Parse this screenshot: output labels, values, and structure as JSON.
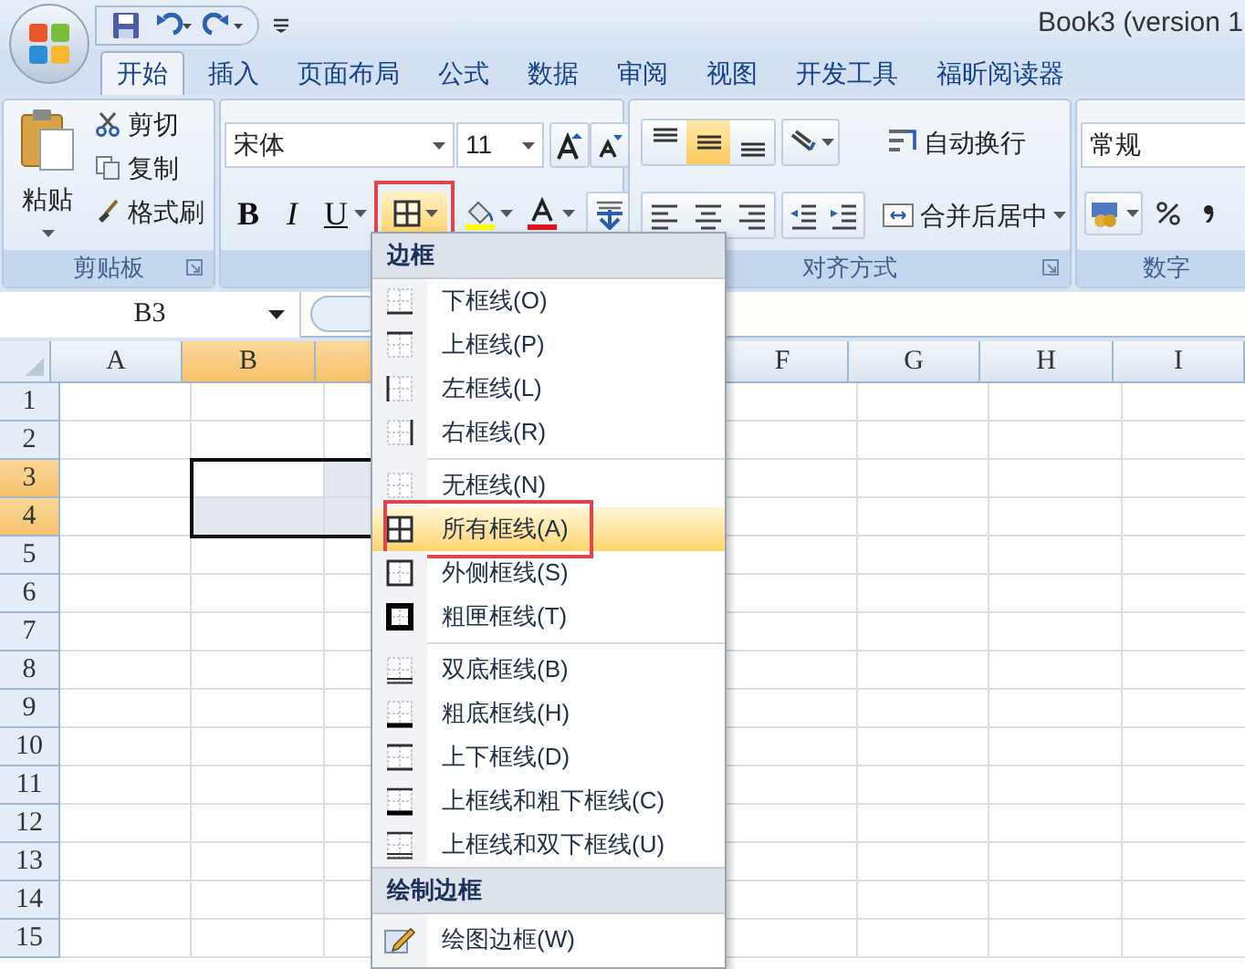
{
  "title_bar": {
    "title": "Book3 (version 1"
  },
  "tabs": [
    {
      "label": "开始",
      "selected": true
    },
    {
      "label": "插入",
      "selected": false
    },
    {
      "label": "页面布局",
      "selected": false
    },
    {
      "label": "公式",
      "selected": false
    },
    {
      "label": "数据",
      "selected": false
    },
    {
      "label": "审阅",
      "selected": false
    },
    {
      "label": "视图",
      "selected": false
    },
    {
      "label": "开发工具",
      "selected": false
    },
    {
      "label": "福昕阅读器",
      "selected": false
    }
  ],
  "ribbon": {
    "clipboard": {
      "paste": "粘贴",
      "commands": [
        {
          "kind": "cut",
          "label": "剪切"
        },
        {
          "kind": "copy",
          "label": "复制"
        },
        {
          "kind": "format_painter",
          "label": "格式刷"
        }
      ],
      "group_label": "剪贴板"
    },
    "font": {
      "font_name": "宋体",
      "font_size": "11",
      "bold": "B",
      "italic": "I",
      "underline": "U",
      "border_button": {
        "annotated": true
      }
    },
    "alignment": {
      "vertical_align": [
        {
          "kind": "top",
          "selected": false
        },
        {
          "kind": "middle",
          "selected": true
        },
        {
          "kind": "bottom",
          "selected": false
        }
      ],
      "wrap_text": "自动换行",
      "merge_center": "合并后居中",
      "group_label": "对齐方式"
    },
    "number": {
      "format": "常规",
      "group_label": "数字"
    }
  },
  "name_box": {
    "value": "B3"
  },
  "sheet": {
    "columns": [
      {
        "label": "A",
        "selected": false
      },
      {
        "label": "B",
        "selected": true
      },
      {
        "selected": true
      },
      {
        "label": "F",
        "selected": false
      },
      {
        "label": "G",
        "selected": false
      },
      {
        "label": "H",
        "selected": false
      },
      {
        "label": "I",
        "selected": false
      }
    ],
    "rows": [
      {
        "label": "1",
        "selected": false
      },
      {
        "label": "2",
        "selected": false
      },
      {
        "label": "3",
        "selected": true
      },
      {
        "label": "4",
        "selected": true
      },
      {
        "label": "5",
        "selected": false
      },
      {
        "label": "6",
        "selected": false
      },
      {
        "label": "7",
        "selected": false
      },
      {
        "label": "8",
        "selected": false
      },
      {
        "label": "9",
        "selected": false
      },
      {
        "label": "10",
        "selected": false
      },
      {
        "label": "11",
        "selected": false
      },
      {
        "label": "12",
        "selected": false
      },
      {
        "label": "13",
        "selected": false
      },
      {
        "label": "14",
        "selected": false
      },
      {
        "label": "15",
        "selected": false
      }
    ]
  },
  "border_menu": {
    "header": "边框",
    "groups": [
      [
        {
          "kind": "bottom",
          "label": "下框线(O)",
          "selected": false,
          "annotated": false
        },
        {
          "kind": "top",
          "label": "上框线(P)",
          "selected": false,
          "annotated": false
        },
        {
          "kind": "left",
          "label": "左框线(L)",
          "selected": false,
          "annotated": false
        },
        {
          "kind": "right",
          "label": "右框线(R)",
          "selected": false,
          "annotated": false
        }
      ],
      [
        {
          "kind": "none",
          "label": "无框线(N)",
          "selected": false,
          "annotated": false
        },
        {
          "kind": "all",
          "label": "所有框线(A)",
          "selected": true,
          "annotated": true
        },
        {
          "kind": "outside",
          "label": "外侧框线(S)",
          "selected": false,
          "annotated": false
        },
        {
          "kind": "thick_box",
          "label": "粗匣框线(T)",
          "selected": false,
          "annotated": false
        }
      ],
      [
        {
          "kind": "double_bottom",
          "label": "双底框线(B)",
          "selected": false,
          "annotated": false
        },
        {
          "kind": "thick_bottom",
          "label": "粗底框线(H)",
          "selected": false,
          "annotated": false
        },
        {
          "kind": "top_bottom",
          "label": "上下框线(D)",
          "selected": false,
          "annotated": false
        },
        {
          "kind": "top_thick_bottom",
          "label": "上框线和粗下框线(C)",
          "selected": false,
          "annotated": false
        },
        {
          "kind": "top_double_bottom",
          "label": "上框线和双下框线(U)",
          "selected": false,
          "annotated": false
        }
      ]
    ],
    "draw_header": "绘制边框",
    "draw_items": [
      {
        "kind": "draw",
        "label": "绘图边框(W)"
      }
    ]
  }
}
